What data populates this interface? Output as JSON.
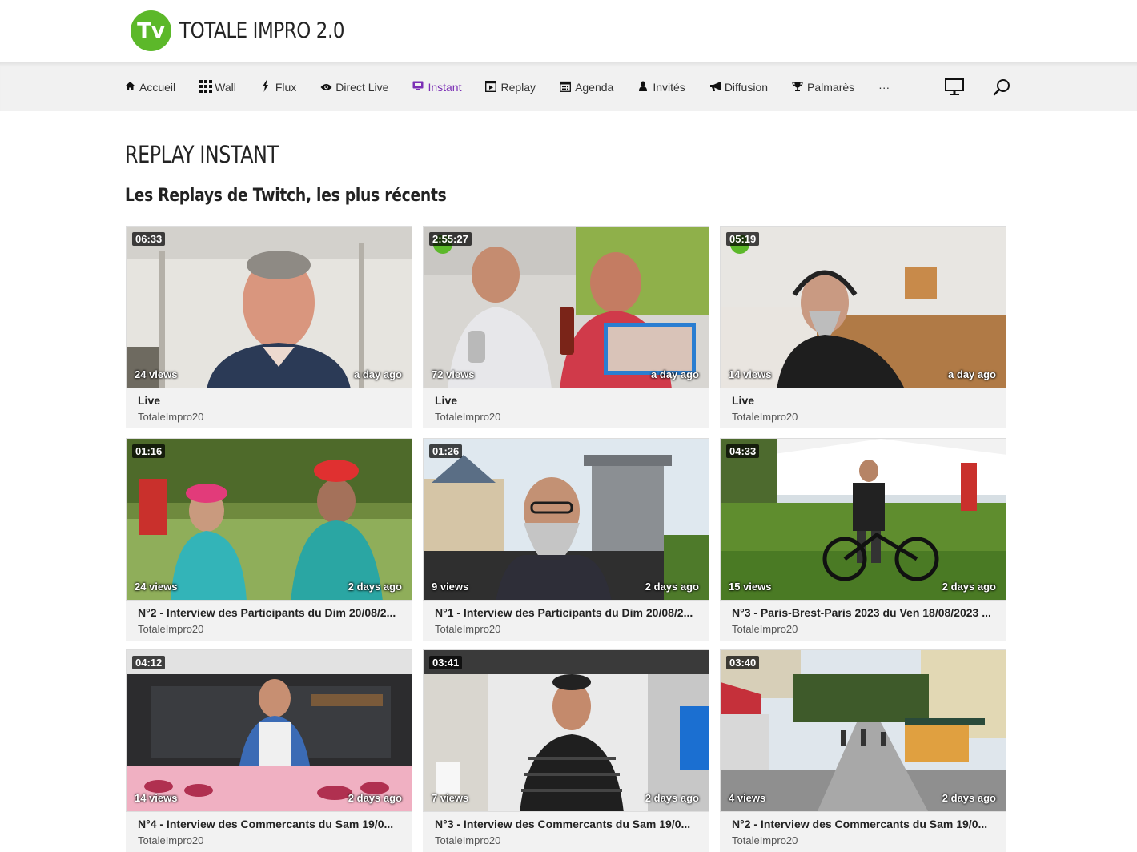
{
  "site": {
    "logo_mark": "Tv",
    "title": "TOTALE IMPRO 2.0",
    "brand_color": "#5cb82a",
    "accent_color": "#7b2fb5"
  },
  "nav": {
    "items": [
      {
        "label": "Accueil",
        "icon": "home-icon"
      },
      {
        "label": "Wall",
        "icon": "grid-icon"
      },
      {
        "label": "Flux",
        "icon": "bolt-icon"
      },
      {
        "label": "Direct Live",
        "icon": "eye-icon"
      },
      {
        "label": "Instant",
        "icon": "twitch-icon",
        "active": true
      },
      {
        "label": "Replay",
        "icon": "play-square-icon"
      },
      {
        "label": "Agenda",
        "icon": "calendar-icon"
      },
      {
        "label": "Invités",
        "icon": "user-icon"
      },
      {
        "label": "Diffusion",
        "icon": "megaphone-icon"
      },
      {
        "label": "Palmarès",
        "icon": "trophy-icon"
      },
      {
        "label": "···",
        "icon": "more-icon"
      }
    ],
    "right_icons": [
      "monitor-icon",
      "search-icon"
    ]
  },
  "page": {
    "title": "REPLAY INSTANT",
    "subtitle": "Les Replays de Twitch, les plus récents"
  },
  "videos": [
    {
      "duration": "06:33",
      "views": "24 views",
      "ago": "a day ago",
      "title": "Live",
      "channel": "TotaleImpro20"
    },
    {
      "duration": "2:55:27",
      "views": "72 views",
      "ago": "a day ago",
      "title": "Live",
      "channel": "TotaleImpro20"
    },
    {
      "duration": "05:19",
      "views": "14 views",
      "ago": "a day ago",
      "title": "Live",
      "channel": "TotaleImpro20"
    },
    {
      "duration": "01:16",
      "views": "24 views",
      "ago": "2 days ago",
      "title": "N°2 - Interview des Participants du Dim 20/08/2...",
      "channel": "TotaleImpro20"
    },
    {
      "duration": "01:26",
      "views": "9 views",
      "ago": "2 days ago",
      "title": "N°1 - Interview des Participants du Dim 20/08/2...",
      "channel": "TotaleImpro20"
    },
    {
      "duration": "04:33",
      "views": "15 views",
      "ago": "2 days ago",
      "title": "N°3 - Paris-Brest-Paris 2023 du Ven 18/08/2023 ...",
      "channel": "TotaleImpro20"
    },
    {
      "duration": "04:12",
      "views": "14 views",
      "ago": "2 days ago",
      "title": "N°4 - Interview des Commercants du Sam 19/0...",
      "channel": "TotaleImpro20"
    },
    {
      "duration": "03:41",
      "views": "7 views",
      "ago": "2 days ago",
      "title": "N°3 - Interview des Commercants du Sam 19/0...",
      "channel": "TotaleImpro20"
    },
    {
      "duration": "03:40",
      "views": "4 views",
      "ago": "2 days ago",
      "title": "N°2 - Interview des Commercants du Sam 19/0...",
      "channel": "TotaleImpro20"
    }
  ]
}
